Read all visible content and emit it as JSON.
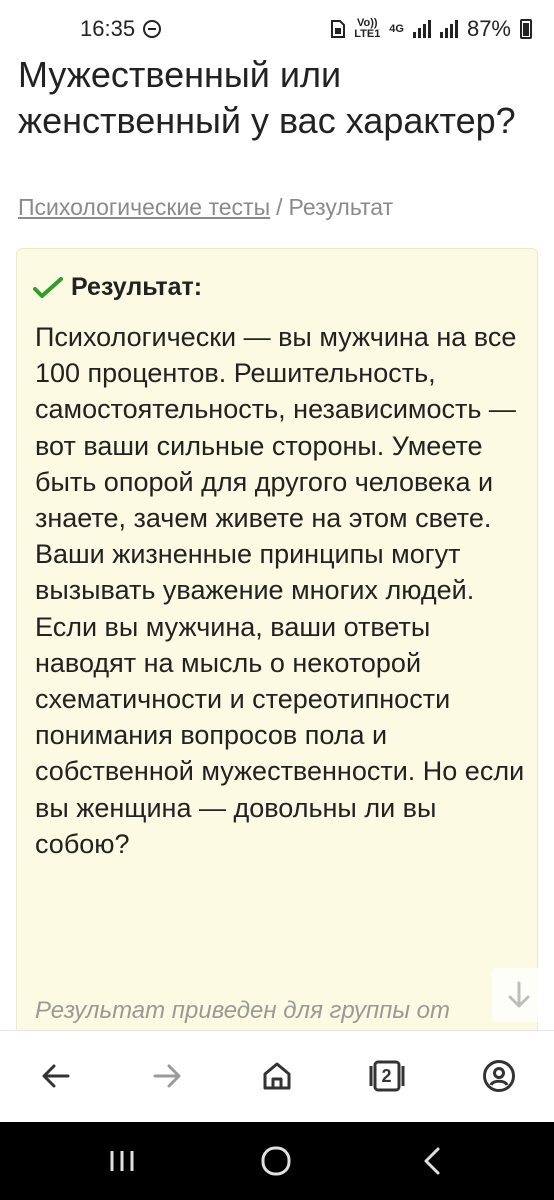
{
  "status_bar": {
    "time": "16:35",
    "volte_label": "Vo)) LTE1",
    "network_label": "4G",
    "battery": "87%"
  },
  "page": {
    "title": "Мужественный или женственный у вас характер?",
    "breadcrumb": {
      "link": "Психологические тесты",
      "separator": "/",
      "current": "Результат"
    }
  },
  "result": {
    "heading": "Результат:",
    "text": "Психологически — вы мужчина на все 100 процентов. Решительность, самостоятельность, независимость — вот ваши сильные стороны. Умеете быть опорой для другого человека и знаете, зачем живете на этом свете. Ваши жизненные принципы могут вызывать уважение многих людей. Если вы мужчина, ваши ответы наводят на мысль о некоторой схематичности и стереотипности понимания вопросов пола и собственной мужественности. Но если вы женщина — довольны ли вы собою?",
    "note": "Результат приведен для группы от"
  },
  "toolbar": {
    "tabs_count": "2"
  },
  "colors": {
    "result_bg": "#fcfae2",
    "check": "#2f9e2a",
    "nav_bg": "#000000"
  }
}
